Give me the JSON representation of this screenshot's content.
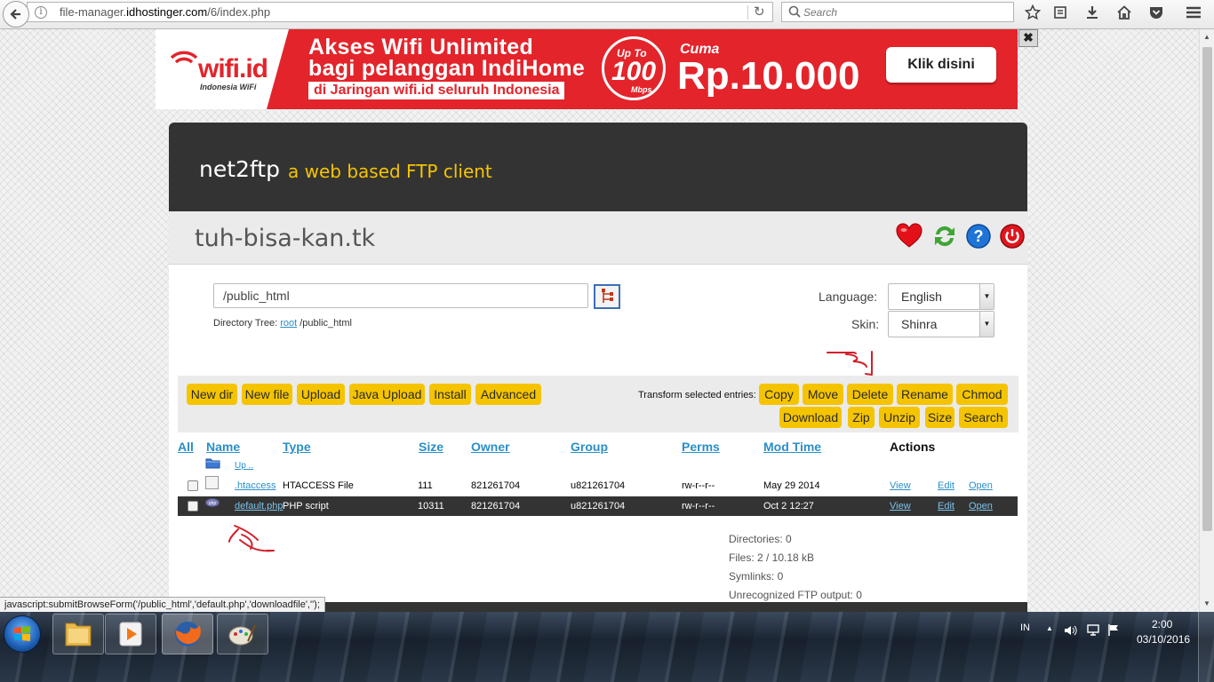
{
  "browser": {
    "url_prefix": "file-manager.",
    "url_domain": "idhostinger.com",
    "url_path": "/6/index.php",
    "search_placeholder": "Search",
    "status_text": "javascript:submitBrowseForm('/public_html','default.php','downloadfile','');"
  },
  "banner": {
    "logo": "wifi.id",
    "logo_sub": "Indonesia WiFi",
    "line1": "Akses Wifi Unlimited",
    "line2": "bagi pelanggan IndiHome",
    "line3": "di Jaringan wifi.id seluruh Indonesia",
    "badge_top": "Up To",
    "badge_num": "100",
    "badge_unit": "Mbps",
    "cuma": "Cuma",
    "price": "Rp.10.000",
    "cta": "Klik disini",
    "close": "✖"
  },
  "app": {
    "title": "net2ftp",
    "tagline": "a web based FTP client",
    "host": "tuh-bisa-kan.tk"
  },
  "browse": {
    "directory": "/public_html",
    "tree_label": "Directory Tree:",
    "tree_root": "root",
    "tree_path": "/public_html",
    "language_label": "Language:",
    "language_value": "English",
    "skin_label": "Skin:",
    "skin_value": "Shinra"
  },
  "actions": {
    "left": [
      "New dir",
      "New file",
      "Upload",
      "Java Upload",
      "Install",
      "Advanced"
    ],
    "transform_label": "Transform selected entries:",
    "right_row1": [
      "Copy",
      "Move",
      "Delete",
      "Rename",
      "Chmod"
    ],
    "right_row2": [
      "Download",
      "Zip",
      "Unzip",
      "Size",
      "Search"
    ]
  },
  "table": {
    "headers": {
      "all": "All",
      "name": "Name",
      "type": "Type",
      "size": "Size",
      "owner": "Owner",
      "group": "Group",
      "perms": "Perms",
      "modtime": "Mod Time",
      "actions": "Actions"
    },
    "up_label": "Up ..",
    "rows": [
      {
        "name": ".htaccess",
        "type": "HTACCESS File",
        "size": "111",
        "owner": "821261704",
        "group": "u821261704",
        "perms": "rw-r--r--",
        "modtime": "May 29 2014",
        "view": "View",
        "edit": "Edit",
        "open": "Open"
      },
      {
        "name": "default.php",
        "type": "PHP script",
        "size": "10311",
        "owner": "821261704",
        "group": "u821261704",
        "perms": "rw-r--r--",
        "modtime": "Oct 2 12:27",
        "view": "View",
        "edit": "Edit",
        "open": "Open"
      }
    ]
  },
  "stats": {
    "directories": "Directories: 0",
    "files": "Files: 2 / 10.18 kB",
    "symlinks": "Symlinks: 0",
    "unrecognized": "Unrecognized FTP output: 0"
  },
  "taskbar": {
    "lang": "IN",
    "time": "2:00",
    "date": "03/10/2016"
  },
  "colors": {
    "accent_yellow": "#f5c400",
    "header_dark": "#333333",
    "link_blue": "#2a8fc6",
    "annotation_red": "#d0202a"
  }
}
